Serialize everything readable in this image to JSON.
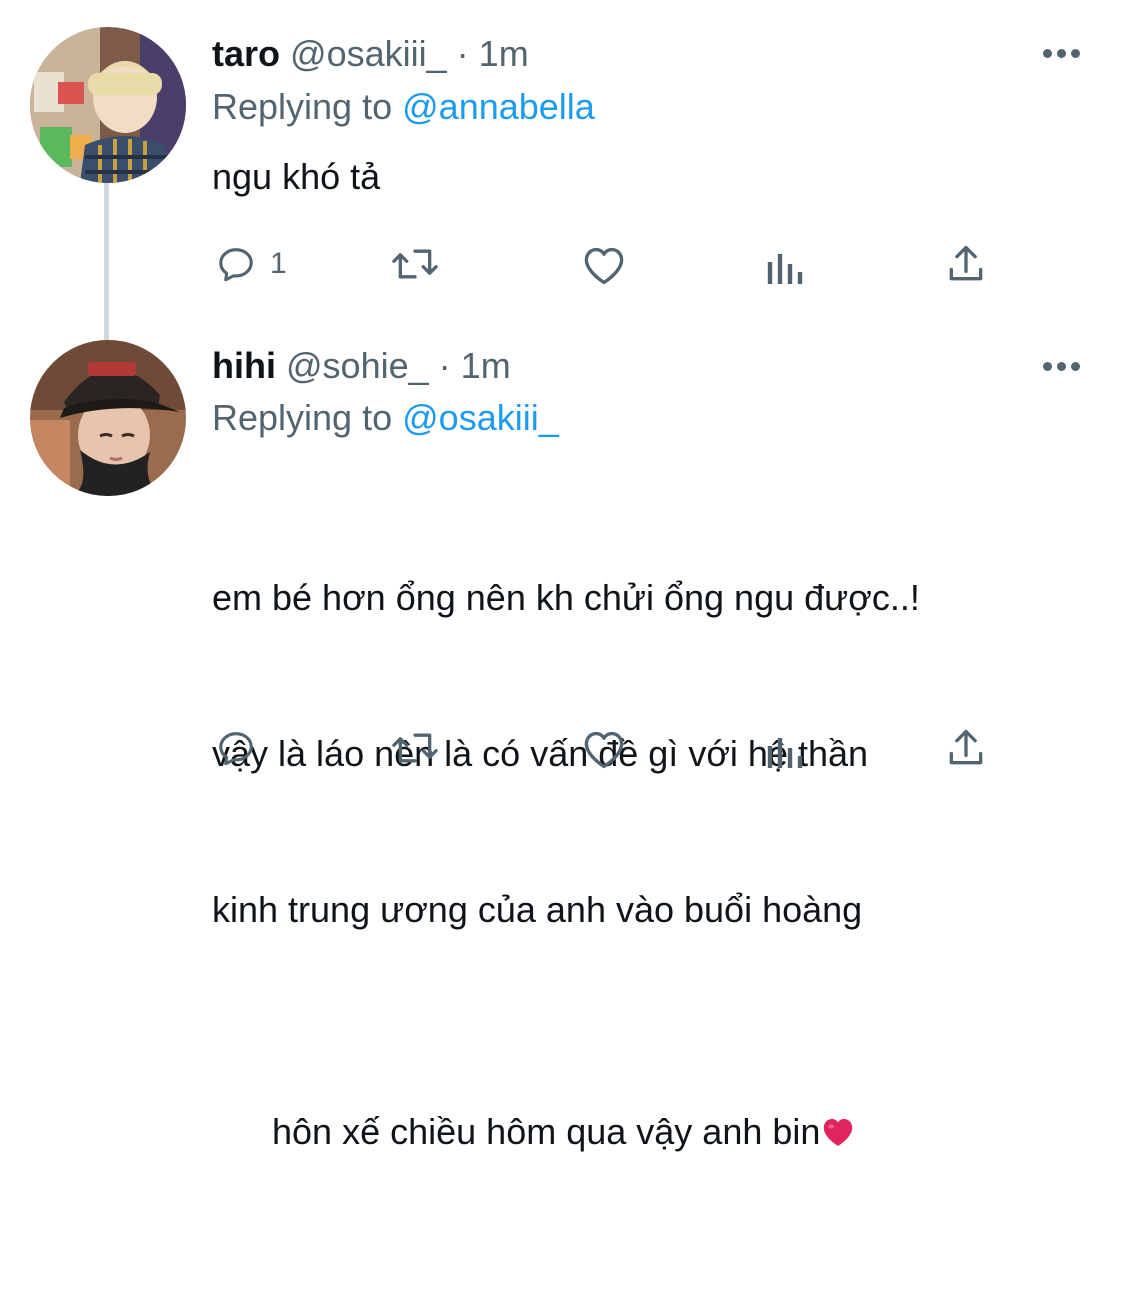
{
  "thread": [
    {
      "display_name": "taro",
      "handle": "@osakiii_",
      "separator": "·",
      "time": "1m",
      "replying_label": "Replying to",
      "replying_to": "@annabella",
      "text": "ngu khó tả",
      "actions": {
        "reply_count": "1",
        "retweet_count": "",
        "like_count": ""
      }
    },
    {
      "display_name": "hihi",
      "handle": "@sohie_",
      "separator": "·",
      "time": "1m",
      "replying_label": "Replying to",
      "replying_to": "@osakiii_",
      "text_lines": [
        "em bé hơn ổng nên kh chửi ổng ngu được..!",
        "vậy là láo nên là có vấn đề gì với hệ thần",
        "kinh trung ương của anh vào buổi hoàng",
        "hôn xế chiều hôm qua vậy anh bin"
      ],
      "emoji": "red-heart",
      "actions": {
        "reply_count": "",
        "retweet_count": "",
        "like_count": ""
      }
    }
  ],
  "icons": [
    "reply-icon",
    "retweet-icon",
    "like-icon",
    "analytics-icon",
    "share-icon",
    "more-icon"
  ],
  "colors": {
    "text": "#0f1419",
    "secondary": "#536471",
    "accent": "#1d9bf0",
    "thread_line": "#cfd9de",
    "heart": "#e0245e"
  }
}
